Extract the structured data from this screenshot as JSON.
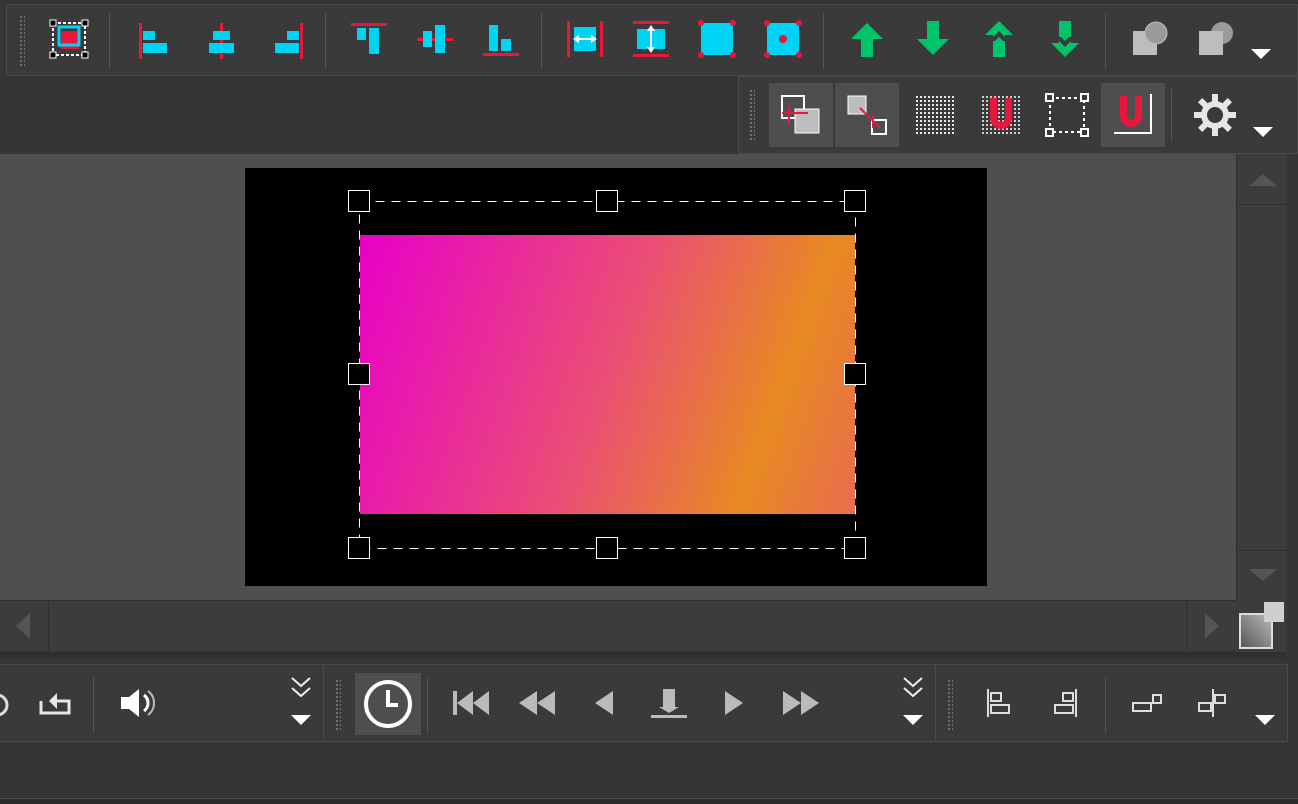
{
  "window": {
    "title": ""
  },
  "toolbar_top": {
    "buttons": [
      {
        "icon": "select-object-icon"
      },
      {
        "icon": "align-left-icon"
      },
      {
        "icon": "align-center-horizontal-icon"
      },
      {
        "icon": "align-right-icon"
      },
      {
        "icon": "align-top-icon"
      },
      {
        "icon": "align-center-vertical-icon"
      },
      {
        "icon": "align-bottom-icon"
      },
      {
        "icon": "distribute-horizontal-icon"
      },
      {
        "icon": "distribute-vertical-icon"
      },
      {
        "icon": "shape-cyan-corners-icon"
      },
      {
        "icon": "shape-cyan-center-icon"
      },
      {
        "icon": "bring-forward-icon"
      },
      {
        "icon": "send-backward-icon"
      },
      {
        "icon": "bring-to-front-icon"
      },
      {
        "icon": "send-to-back-icon"
      },
      {
        "icon": "shape-front-icon"
      },
      {
        "icon": "shape-back-icon"
      }
    ]
  },
  "toolbar_snap": {
    "buttons": [
      {
        "icon": "snap-to-bounding-box-icon",
        "active": true
      },
      {
        "icon": "snap-to-corner-icon",
        "active": true
      },
      {
        "icon": "snap-to-grid-icon",
        "active": false
      },
      {
        "icon": "snap-magnet-grid-icon",
        "active": false
      },
      {
        "icon": "snap-to-frame-icon",
        "active": false
      },
      {
        "icon": "snap-magnet-guide-icon",
        "active": true
      },
      {
        "icon": "settings-gear-icon",
        "active": false
      }
    ]
  },
  "canvas": {
    "gradient_start": "#e800c8",
    "gradient_mid": "#ea4f74",
    "gradient_end": "#e88a22",
    "background": "#000000"
  },
  "transport": {
    "buttons": [
      {
        "icon": "loop-icon"
      },
      {
        "icon": "volume-icon"
      },
      {
        "icon": "clock-icon"
      },
      {
        "icon": "skip-to-start-icon"
      },
      {
        "icon": "rewind-icon"
      },
      {
        "icon": "step-back-icon"
      },
      {
        "icon": "stop-icon"
      },
      {
        "icon": "play-icon"
      },
      {
        "icon": "fast-forward-icon"
      },
      {
        "icon": "align-objects-left-icon"
      },
      {
        "icon": "align-objects-right-icon"
      },
      {
        "icon": "link-right-icon"
      },
      {
        "icon": "link-left-icon"
      }
    ]
  },
  "colors": {
    "accent_red": "#e8173c",
    "accent_cyan": "#00d4f5",
    "accent_green": "#00c46a"
  }
}
